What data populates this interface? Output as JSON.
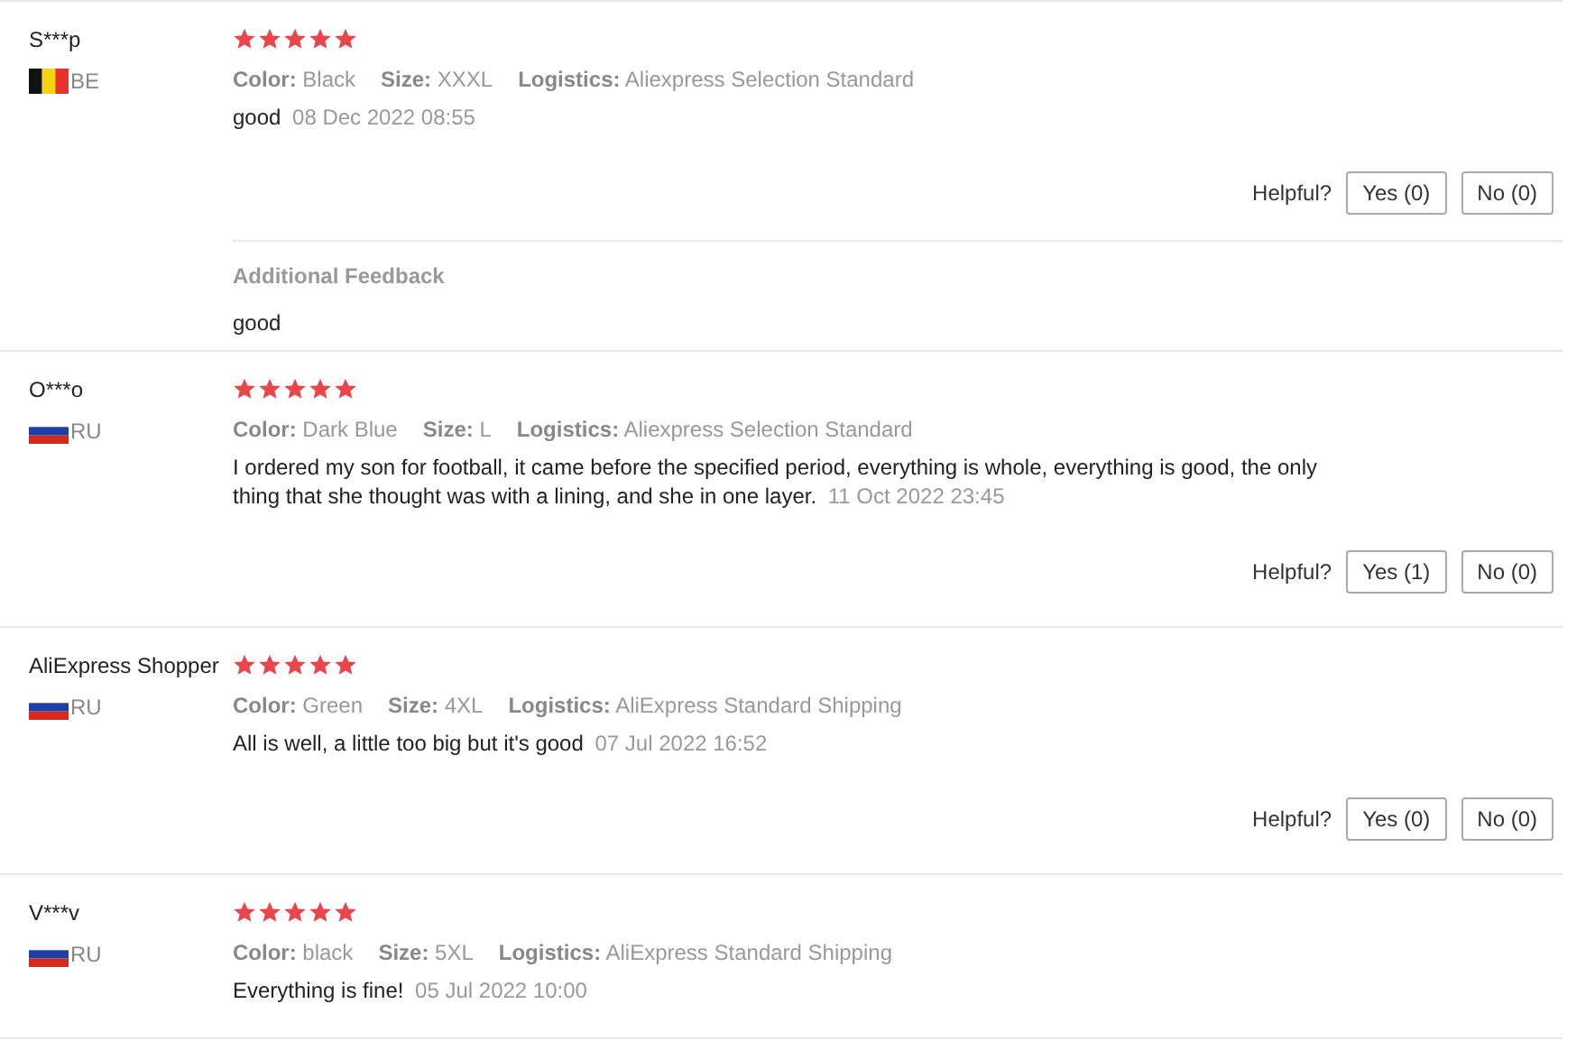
{
  "reviews": [
    {
      "user": "S***p",
      "country": "BE",
      "flag": {
        "kind": "vertical"
      },
      "stars": 5,
      "attributes": [
        "**Color:** Black",
        "**Size:** XXXL",
        "**Logistics:** Aliexpress Selection Standard"
      ],
      "comment": "good",
      "date": "08 Dec 2022 08:55",
      "helpful_label": "Helpful?",
      "yes": "Yes (0)",
      "no": "No (0)",
      "additional": {
        "title": "Additional Feedback",
        "text": "good"
      }
    },
    {
      "user": "O***o",
      "country": "RU",
      "flag": {
        "kind": "horizontal"
      },
      "stars": 5,
      "attributes": [
        "**Color:** Dark Blue",
        "**Size:** L",
        "**Logistics:** Aliexpress Selection Standard"
      ],
      "comment": "I ordered my son for football, it came before the specified period, everything is whole, everything is good, the only thing that she thought was with a lining, and she in one layer.",
      "date": "11 Oct 2022 23:45",
      "helpful_label": "Helpful?",
      "yes": "Yes (1)",
      "no": "No (0)"
    },
    {
      "user": "AliExpress Shopper",
      "country": "RU",
      "flag": {
        "kind": "horizontal"
      },
      "stars": 5,
      "attributes": [
        "**Color:** Green",
        "**Size:** 4XL",
        "**Logistics:** AliExpress Standard Shipping"
      ],
      "comment": "All is well, a little too big but it's good",
      "date": "07 Jul 2022 16:52",
      "helpful_label": "Helpful?",
      "yes": "Yes (0)",
      "no": "No (0)"
    },
    {
      "user": "V***v",
      "country": "RU",
      "flag": {
        "kind": "horizontal"
      },
      "stars": 5,
      "attributes": [
        "**Color:** black",
        "**Size:** 5XL",
        "**Logistics:** AliExpress Standard Shipping"
      ],
      "comment": "Everything is fine!",
      "date": "05 Jul 2022 10:00"
    }
  ]
}
